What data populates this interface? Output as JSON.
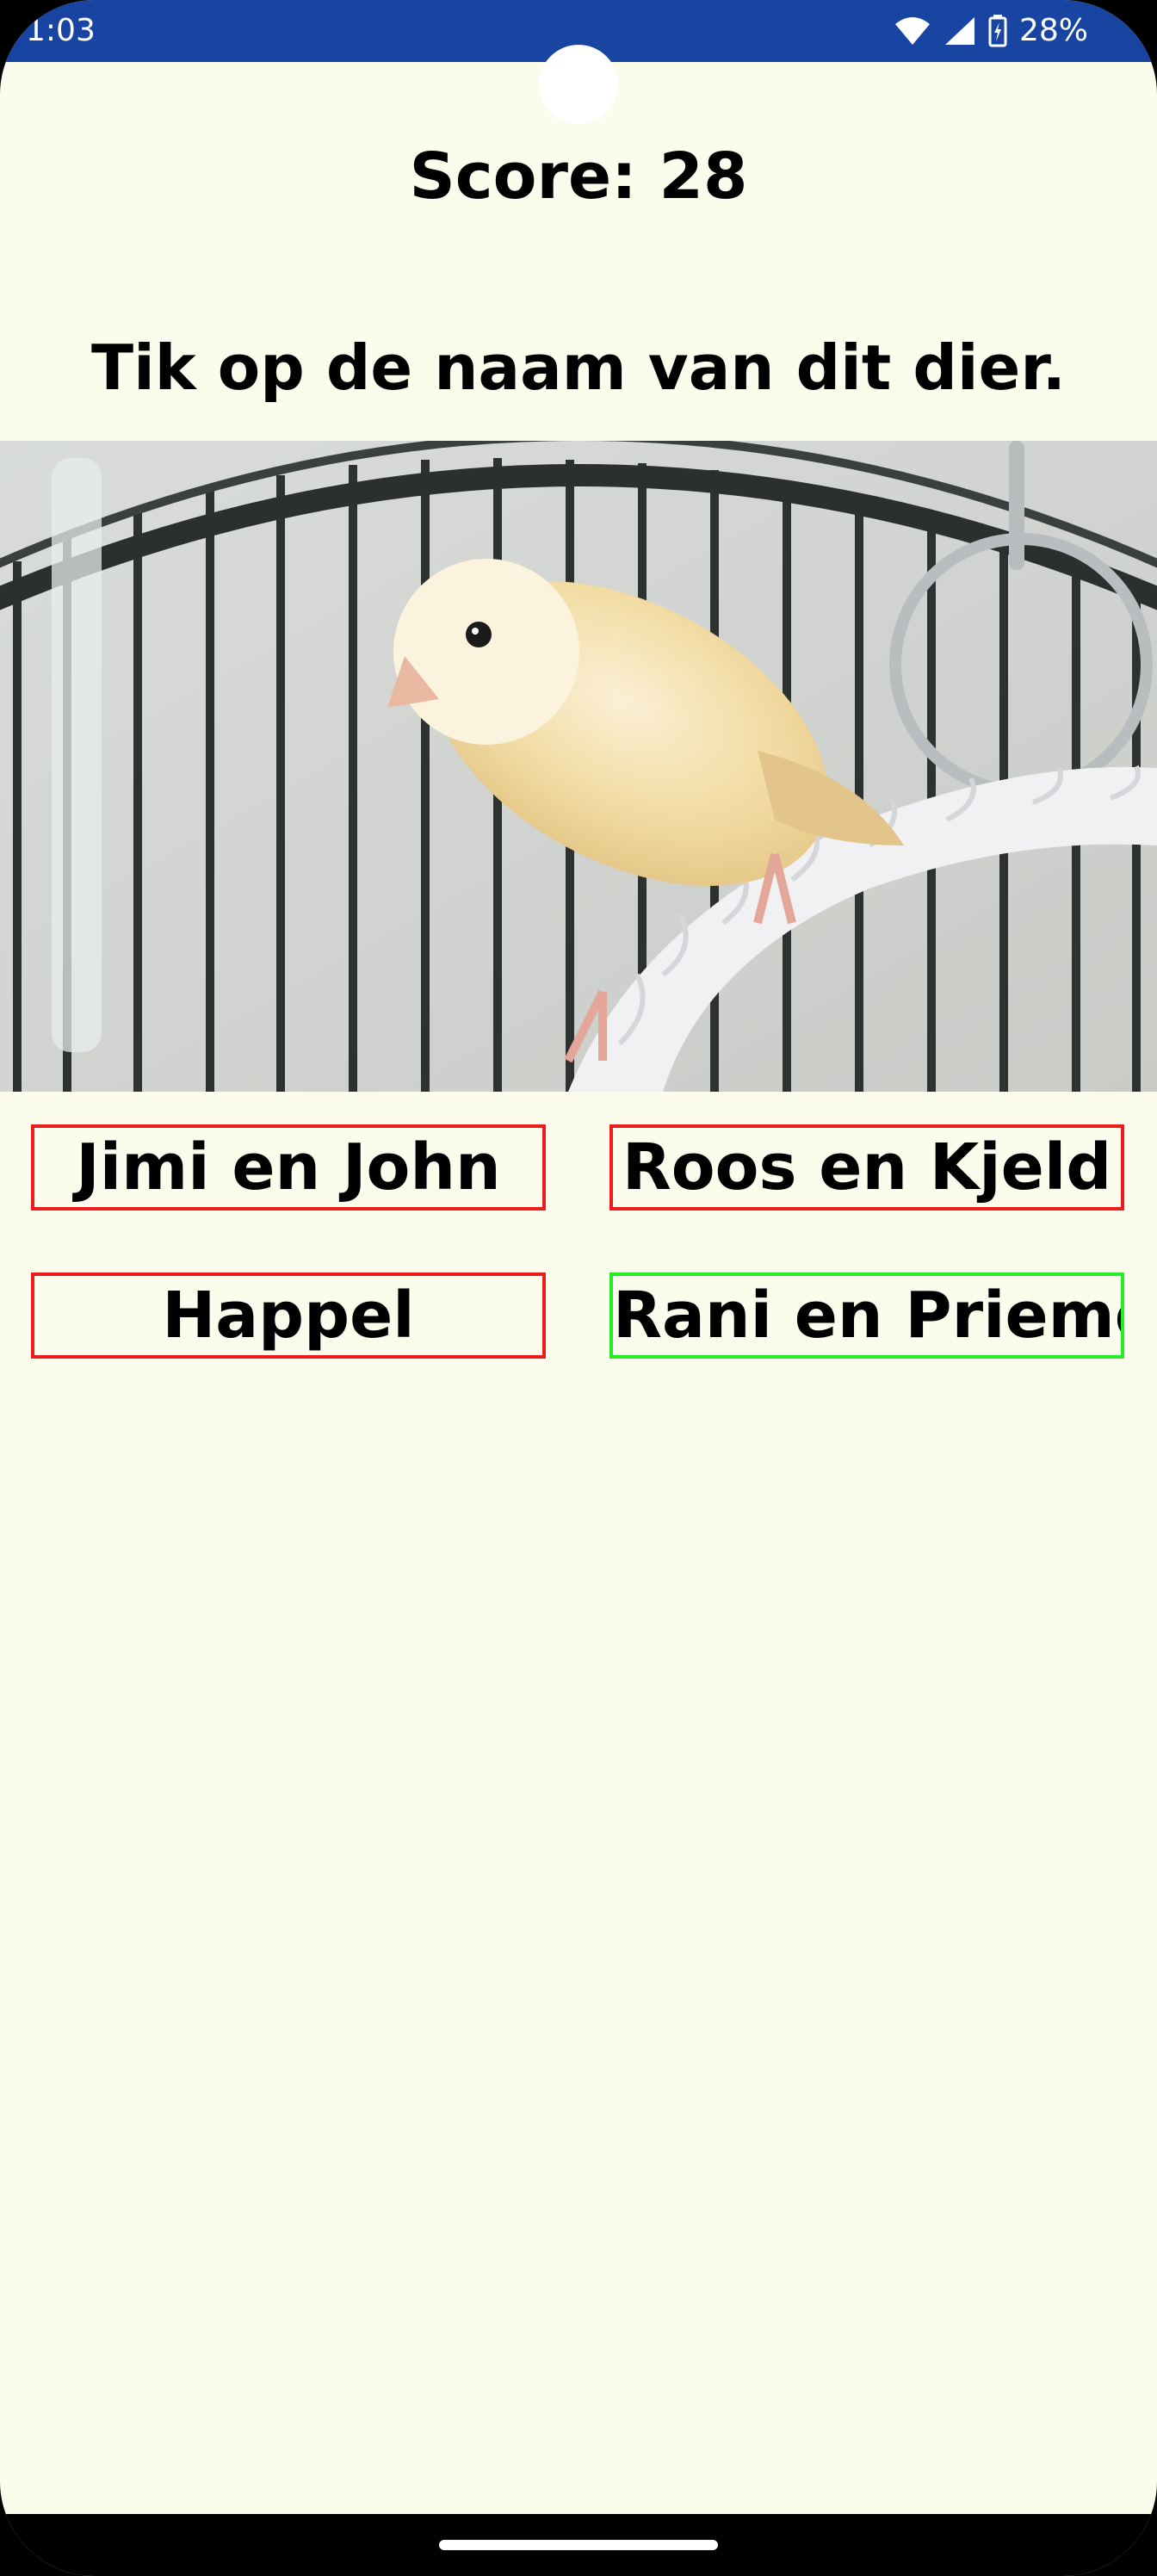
{
  "status_bar": {
    "time": "1:03",
    "battery_percent": "28%",
    "icons": [
      "wifi-icon",
      "signal-icon",
      "battery-charging-icon"
    ]
  },
  "game": {
    "score_label": "Score: 28",
    "instruction": "Tik op de naam van dit dier.",
    "answers": [
      {
        "label": "Jimi en John",
        "state": "wrong"
      },
      {
        "label": "Roos en Kjeld",
        "state": "wrong"
      },
      {
        "label": "Happel",
        "state": "wrong"
      },
      {
        "label": "Rani en Priemo",
        "state": "correct"
      }
    ]
  },
  "colors": {
    "background": "#fbfcec",
    "status_bar": "#1845a2",
    "wrong_border": "#ee1d1d",
    "correct_border": "#22ee22"
  }
}
